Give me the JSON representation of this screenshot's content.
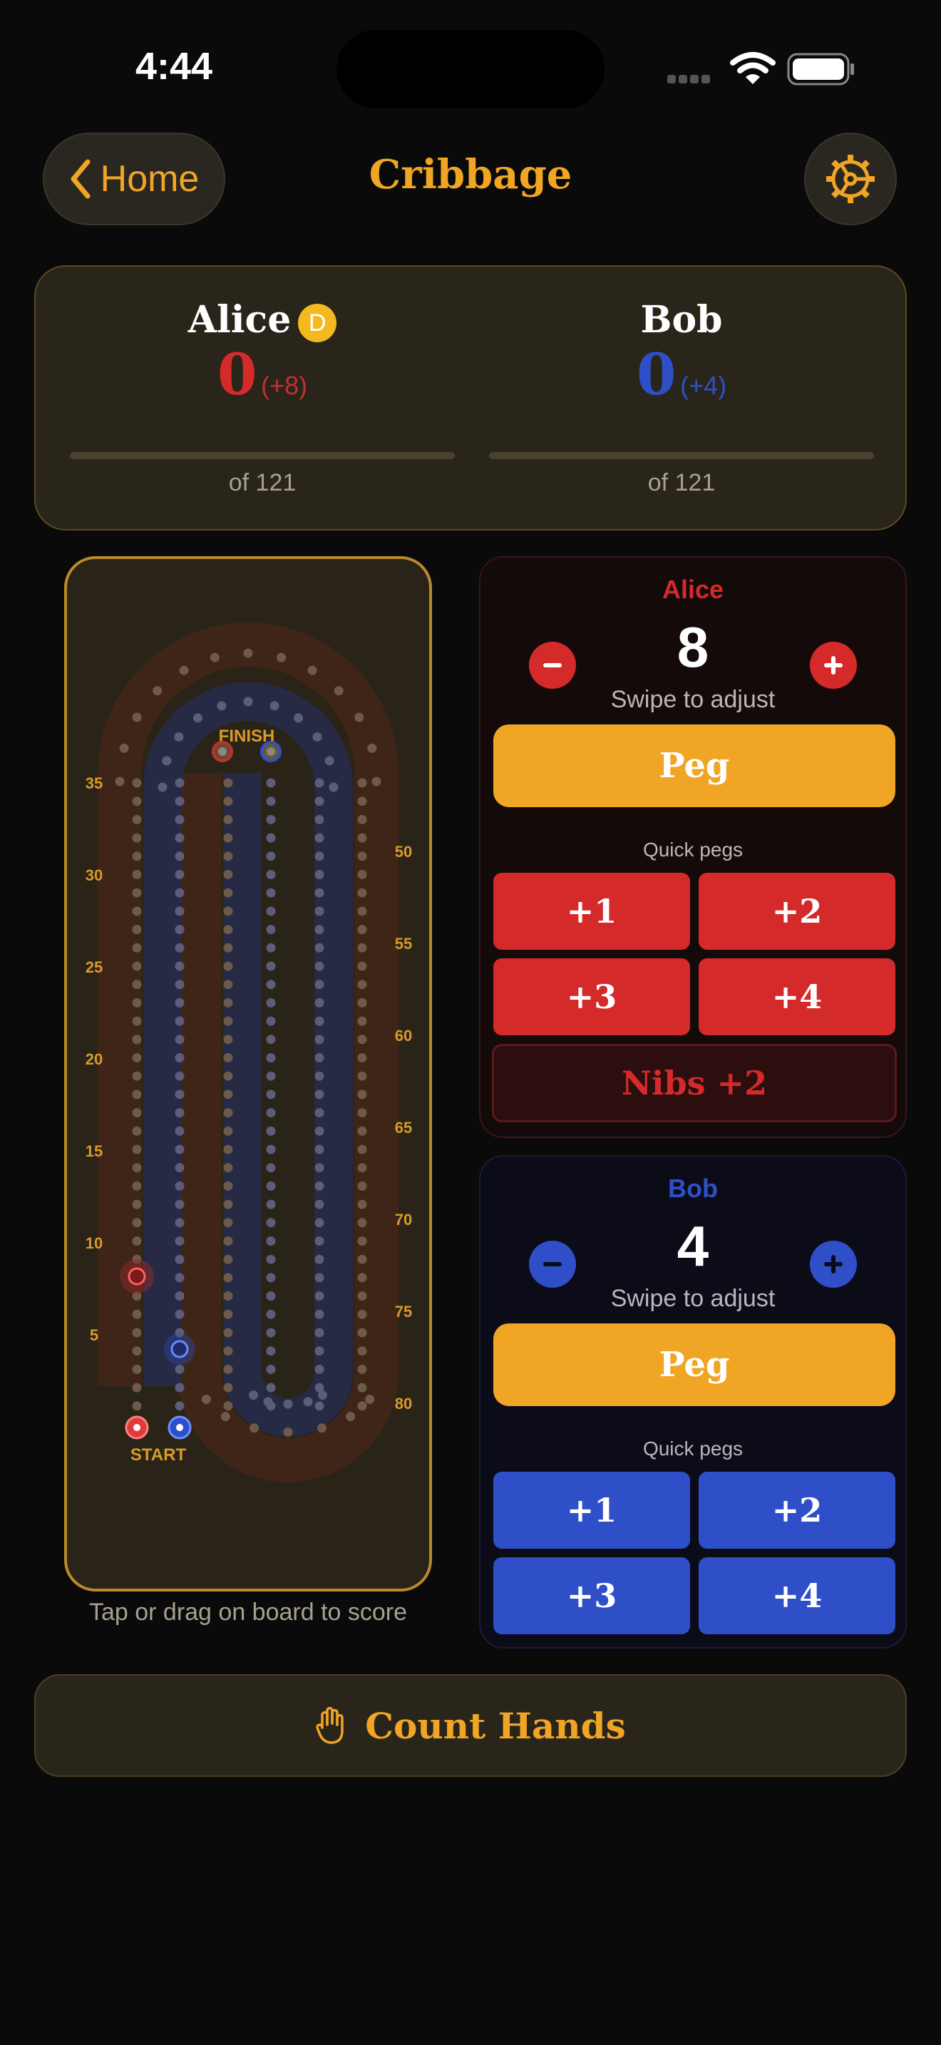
{
  "status_bar": {
    "time": "4:44"
  },
  "nav": {
    "back_label": "Home",
    "title": "Cribbage"
  },
  "scoreboard": {
    "players": [
      {
        "name": "Alice",
        "score": "0",
        "pending": "(+8)",
        "of_label": "of 121",
        "dealer_badge": "D",
        "progress": 0,
        "color": "#d52a2a"
      },
      {
        "name": "Bob",
        "score": "0",
        "pending": "(+4)",
        "of_label": "of 121",
        "progress": 0,
        "color": "#2f4fc9"
      }
    ]
  },
  "board": {
    "finish_label": "FINISH",
    "start_label": "START",
    "left_labels": [
      "35",
      "30",
      "25",
      "20",
      "15",
      "10",
      "5"
    ],
    "right_labels": [
      "50",
      "55",
      "60",
      "65",
      "70",
      "75",
      "80"
    ],
    "hint": "Tap or drag on board to score"
  },
  "panels": {
    "alice": {
      "name": "Alice",
      "pending": "8",
      "swipe_hint": "Swipe to adjust",
      "peg_label": "Peg",
      "quick_title": "Quick pegs",
      "quick": [
        "+1",
        "+2",
        "+3",
        "+4"
      ],
      "nibs_label": "Nibs +2",
      "color": "#d52a2a"
    },
    "bob": {
      "name": "Bob",
      "pending": "4",
      "swipe_hint": "Swipe to adjust",
      "peg_label": "Peg",
      "quick_title": "Quick pegs",
      "quick": [
        "+1",
        "+2",
        "+3",
        "+4"
      ],
      "color": "#2f4fc9"
    }
  },
  "footer": {
    "count_hands_label": "Count Hands"
  },
  "icons": [
    "back-chevron-icon",
    "gear-icon",
    "hand-icon",
    "wifi-icon",
    "battery-icon",
    "minus-icon",
    "plus-icon"
  ]
}
